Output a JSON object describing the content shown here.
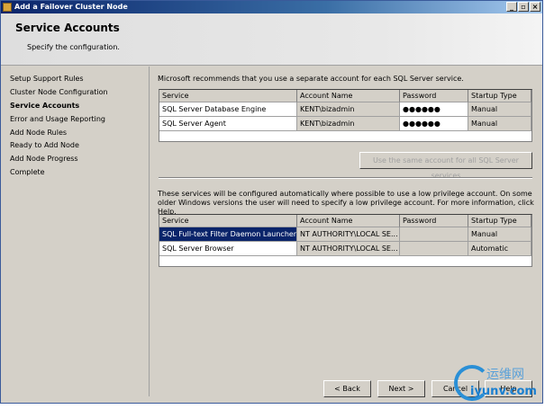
{
  "window": {
    "title": "Add a Failover Cluster Node",
    "controls": [
      "_",
      "▫",
      "×"
    ]
  },
  "header": {
    "title": "Service Accounts",
    "subtitle": "Specify the configuration."
  },
  "nav": {
    "items": [
      "Setup Support Rules",
      "Cluster Node Configuration",
      "Service Accounts",
      "Error and Usage Reporting",
      "Add Node Rules",
      "Ready to Add Node",
      "Add Node Progress",
      "Complete"
    ],
    "current": 2
  },
  "main": {
    "intro": "Microsoft recommends that you use a separate account for each SQL Server service.",
    "columns": [
      "Service",
      "Account Name",
      "Password",
      "Startup Type"
    ],
    "accounts": [
      {
        "service": "SQL Server Database Engine",
        "account": "KENT\\bizadmin",
        "password": "●●●●●●",
        "startup": "Manual"
      },
      {
        "service": "SQL Server Agent",
        "account": "KENT\\bizadmin",
        "password": "●●●●●●",
        "startup": "Manual"
      }
    ],
    "same_account_button": "Use the same account for all SQL Server services",
    "auto_text": "These services will be configured automatically where possible to use a low privilege account. On some older Windows versions the user will need to specify a low privilege account. For more information, click Help.",
    "auto_services": [
      {
        "service": "SQL Full-text Filter Daemon Launcher",
        "account": "NT AUTHORITY\\LOCAL SE...",
        "password": "",
        "startup": "Manual"
      },
      {
        "service": "SQL Server Browser",
        "account": "NT AUTHORITY\\LOCAL SE...",
        "password": "",
        "startup": "Automatic"
      }
    ]
  },
  "buttons": {
    "back": "< Back",
    "next": "Next >",
    "cancel": "Cancel",
    "help": "Help"
  },
  "watermark": {
    "cn": "运维网",
    "en": "iyunv.com"
  }
}
